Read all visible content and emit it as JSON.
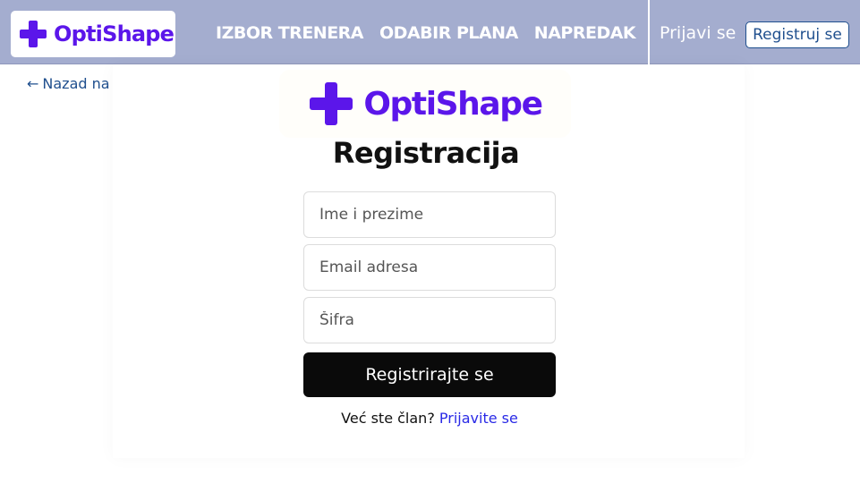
{
  "header": {
    "brand": "OptiShape",
    "nav": [
      "IZBOR TRENERA",
      "ODABIR PLANA",
      "NAPREDAK"
    ],
    "login_label": "Prijavi se",
    "register_label": "Registruj se"
  },
  "back_link": {
    "arrow": "←",
    "label": "Nazad na početnu"
  },
  "form": {
    "brand": "OptiShape",
    "title": "Registracija",
    "name_placeholder": "Ime i prezime",
    "email_placeholder": "Email adresa",
    "password_placeholder": "Šifra",
    "submit_label": "Registrirajte se",
    "member_question": "Već ste član?",
    "login_link": "Prijavite se"
  },
  "colors": {
    "navbar": "#a4adcf",
    "brand": "#5b16ea",
    "link": "#2a2ae6",
    "button": "#0a0a0a"
  },
  "icons": {
    "logo": "plus-cross-icon",
    "back": "arrow-left-icon"
  }
}
